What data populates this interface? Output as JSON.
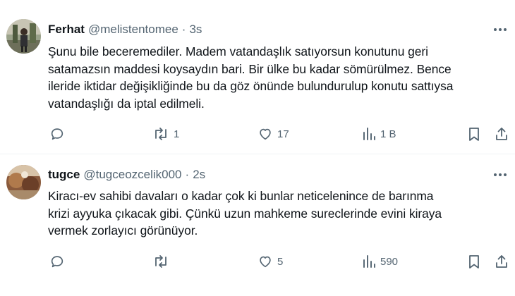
{
  "tweets": [
    {
      "name": "Ferhat",
      "handle": "@melistentomee",
      "separator": "·",
      "time": "3s",
      "text": "Şunu bile beceremediler. Madem vatandaşlık satıyorsun konutunu geri\nsatamazsın maddesi koysaydın bari. Bir ülke bu kadar sömürülmez. Bence\nileride iktidar değişikliğinde bu da göz önünde bulundurulup konutu sattıysa\nvatandaşlığı da iptal edilmeli.",
      "retweets": "1",
      "likes": "17",
      "views": "1 B"
    },
    {
      "name": "tugce",
      "handle": "@tugceozcelik000",
      "separator": "·",
      "time": "2s",
      "text": "Kiracı-ev sahibi davaları o kadar çok ki bunlar neticelenince de barınma\nkrizi ayyuka çıkacak gibi. Çünkü uzun mahkeme sureclerinde evini kiraya\nvermek zorlayıcı görünüyor.",
      "retweets": "",
      "likes": "5",
      "views": "590"
    }
  ],
  "colors": {
    "text": "#0f1419",
    "secondary": "#536471",
    "divider": "#eff3f4"
  },
  "icons": [
    "more-icon",
    "reply-icon",
    "retweet-icon",
    "like-icon",
    "views-icon",
    "bookmark-icon",
    "share-icon"
  ]
}
